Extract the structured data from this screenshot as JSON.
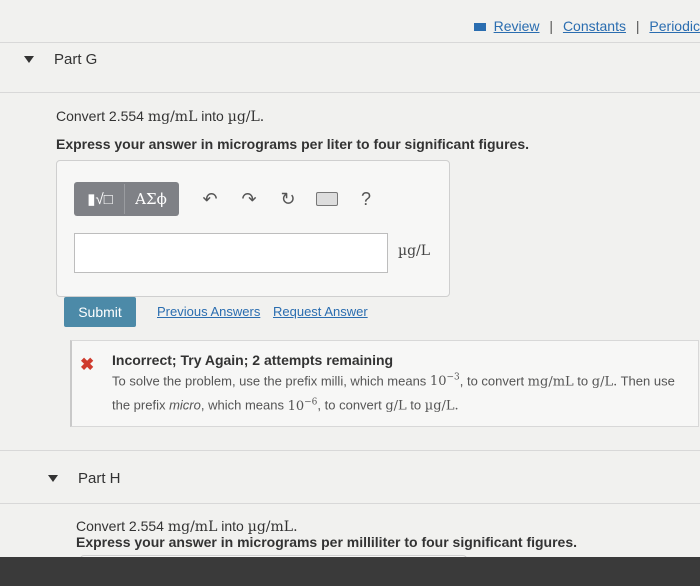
{
  "nav": {
    "review": "Review",
    "constants": "Constants",
    "periodic": "Periodic",
    "sep": "|"
  },
  "partG": {
    "label": "Part G",
    "prompt_pre": "Convert 2.554 ",
    "prompt_from": "mg/mL",
    "prompt_mid": " into ",
    "prompt_to": "µg/L.",
    "instruction": "Express your answer in micrograms per liter to four significant figures.",
    "toolbar": {
      "templates": "▮√□",
      "greek": "ΑΣϕ",
      "undo": "↶",
      "redo": "↷",
      "reset": "↻",
      "help": "?"
    },
    "unit": "µg/L",
    "submit": "Submit",
    "previous_answers": "Previous Answers",
    "request_answer": "Request Answer"
  },
  "feedback": {
    "icon": "✖",
    "title": "Incorrect; Try Again; 2 attempts remaining",
    "line1_a": "To solve the problem, use the prefix milli, which means ",
    "line1_base": "10",
    "line1_exp": "−3",
    "line1_b": ", to convert ",
    "line1_from": "mg/mL",
    "line1_c": " to ",
    "line1_to": "g/L.",
    "line1_d": " Then use",
    "line2_a": "the prefix ",
    "line2_micro": "micro",
    "line2_b": ", which means ",
    "line2_base": "10",
    "line2_exp": "−6",
    "line2_c": ", to convert ",
    "line2_from": "g/L",
    "line2_d": " to ",
    "line2_to": "µg/L."
  },
  "partH": {
    "label": "Part H",
    "prompt_pre": "Convert 2.554 ",
    "prompt_from": "mg/mL",
    "prompt_mid": " into ",
    "prompt_to": "µg/mL.",
    "instruction": "Express your answer in micrograms per milliliter to four significant figures."
  }
}
